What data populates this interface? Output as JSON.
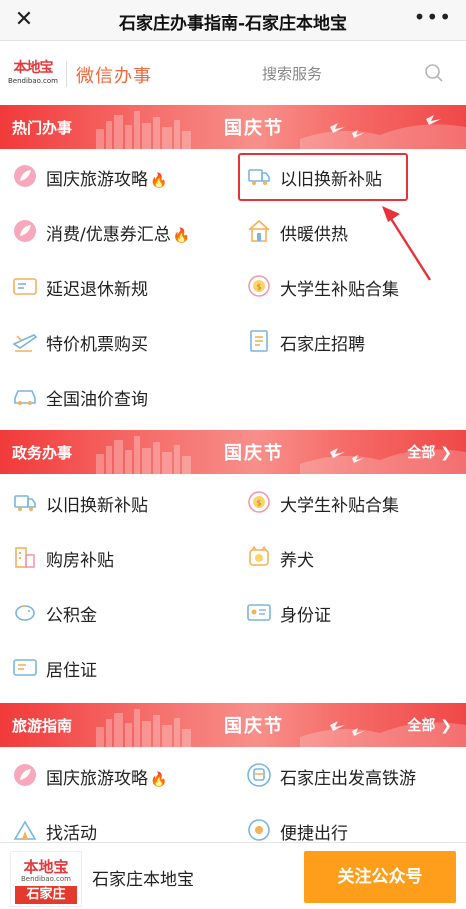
{
  "window": {
    "title": "石家庄办事指南-石家庄本地宝"
  },
  "header": {
    "logo_text": "本地宝",
    "logo_sub": "Bendibao.com",
    "brand_name": "微信办事",
    "search_label": "搜索服务"
  },
  "sections": [
    {
      "category": "热门办事",
      "festival": "国庆节",
      "items": [
        {
          "label": "国庆旅游攻略",
          "hot": true,
          "icon": "leaf-icon"
        },
        {
          "label": "以旧换新补贴",
          "hot": false,
          "icon": "truck-icon"
        },
        {
          "label": "消费/优惠券汇总",
          "hot": true,
          "icon": "leaf-icon"
        },
        {
          "label": "供暖供热",
          "hot": false,
          "icon": "house-icon"
        },
        {
          "label": "延迟退休新规",
          "hot": false,
          "icon": "card-icon"
        },
        {
          "label": "大学生补贴合集",
          "hot": false,
          "icon": "coin-icon"
        },
        {
          "label": "特价机票购买",
          "hot": false,
          "icon": "plane-icon"
        },
        {
          "label": "石家庄招聘",
          "hot": false,
          "icon": "document-icon"
        },
        {
          "label": "全国油价查询",
          "hot": false,
          "icon": "car-icon"
        }
      ]
    },
    {
      "category": "政务办事",
      "festival": "国庆节",
      "all": "全部",
      "items": [
        {
          "label": "以旧换新补贴",
          "hot": false,
          "icon": "truck-icon"
        },
        {
          "label": "大学生补贴合集",
          "hot": false,
          "icon": "coin-icon"
        },
        {
          "label": "购房补贴",
          "hot": false,
          "icon": "building-icon"
        },
        {
          "label": "养犬",
          "hot": false,
          "icon": "dog-icon"
        },
        {
          "label": "公积金",
          "hot": false,
          "icon": "piggy-bank-icon"
        },
        {
          "label": "身份证",
          "hot": false,
          "icon": "id-card-icon"
        },
        {
          "label": "居住证",
          "hot": false,
          "icon": "card-icon"
        }
      ]
    },
    {
      "category": "旅游指南",
      "festival": "国庆节",
      "all": "全部",
      "items": [
        {
          "label": "国庆旅游攻略",
          "hot": true,
          "icon": "leaf-icon"
        },
        {
          "label": "石家庄出发高铁游",
          "hot": false,
          "icon": "train-icon"
        },
        {
          "label": "找活动",
          "hot": false,
          "icon": "tent-icon"
        },
        {
          "label": "便捷出行",
          "hot": false,
          "icon": "compass-icon"
        }
      ]
    }
  ],
  "bottom": {
    "logo_text": "本地宝",
    "logo_sub": "Bendibao.com",
    "logo_city": "石家庄",
    "account_name": "石家庄本地宝",
    "follow_label": "关注公众号"
  },
  "colors": {
    "accent_red": "#e8323a",
    "brand_orange": "#f06a3f",
    "follow_button": "#ff9e1b"
  }
}
